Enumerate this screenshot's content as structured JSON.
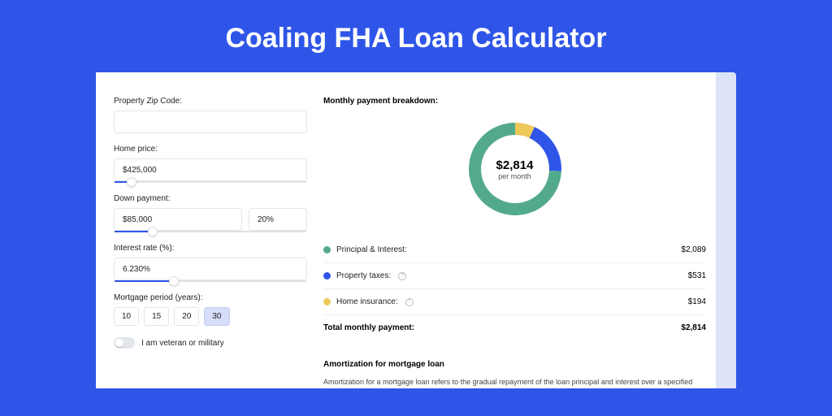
{
  "title": "Coaling FHA Loan Calculator",
  "left": {
    "zip_label": "Property Zip Code:",
    "zip_value": "",
    "home_price_label": "Home price:",
    "home_price_value": "$425,000",
    "home_price_slider_pct": 9,
    "down_payment_label": "Down payment:",
    "down_payment_amount": "$85,000",
    "down_payment_pct": "20%",
    "down_payment_slider_pct": 20,
    "interest_label": "Interest rate (%):",
    "interest_value": "6.230%",
    "interest_slider_pct": 31,
    "period_label": "Mortgage period (years):",
    "period_options": [
      "10",
      "15",
      "20",
      "30"
    ],
    "period_selected": "30",
    "veteran_label": "I am veteran or military",
    "veteran_on": false
  },
  "right": {
    "breakdown_title": "Monthly payment breakdown:",
    "donut_amount": "$2,814",
    "donut_sub": "per month",
    "legend": [
      {
        "label": "Principal & Interest:",
        "value": "$2,089",
        "color": "#53a98e",
        "help": false
      },
      {
        "label": "Property taxes:",
        "value": "$531",
        "color": "#2f55e8",
        "help": true
      },
      {
        "label": "Home insurance:",
        "value": "$194",
        "color": "#edc95a",
        "help": true
      }
    ],
    "total_label": "Total monthly payment:",
    "total_value": "$2,814",
    "amort_title": "Amortization for mortgage loan",
    "amort_body": "Amortization for a mortgage loan refers to the gradual repayment of the loan principal and interest over a specified"
  },
  "chart_data": {
    "type": "pie",
    "title": "Monthly payment breakdown",
    "series": [
      {
        "name": "Principal & Interest",
        "value": 2089,
        "color": "#53a98e"
      },
      {
        "name": "Property taxes",
        "value": 531,
        "color": "#2f55e8"
      },
      {
        "name": "Home insurance",
        "value": 194,
        "color": "#edc95a"
      }
    ],
    "total": 2814,
    "center_label": "$2,814 per month"
  }
}
